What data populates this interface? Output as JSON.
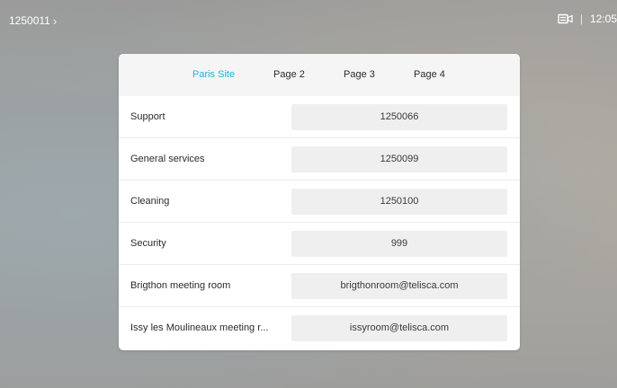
{
  "topbar": {
    "call_id": "1250011",
    "chevron": "›",
    "camera_icon": "camera-icon",
    "separator": "|",
    "time": "12:05"
  },
  "tabs": [
    {
      "label": "Paris Site",
      "active": true
    },
    {
      "label": "Page 2",
      "active": false
    },
    {
      "label": "Page 3",
      "active": false
    },
    {
      "label": "Page 4",
      "active": false
    }
  ],
  "rows": [
    {
      "label": "Support",
      "value": "1250066"
    },
    {
      "label": "General services",
      "value": "1250099"
    },
    {
      "label": "Cleaning",
      "value": "1250100"
    },
    {
      "label": "Security",
      "value": "999"
    },
    {
      "label": "Brigthon meeting room",
      "value": "brigthonroom@telisca.com"
    },
    {
      "label": "Issy les Moulineaux meeting r...",
      "value": "issyroom@telisca.com"
    }
  ],
  "colors": {
    "accent": "#22b5d8",
    "panel_bg": "#ffffff",
    "value_bg": "#efefef"
  }
}
